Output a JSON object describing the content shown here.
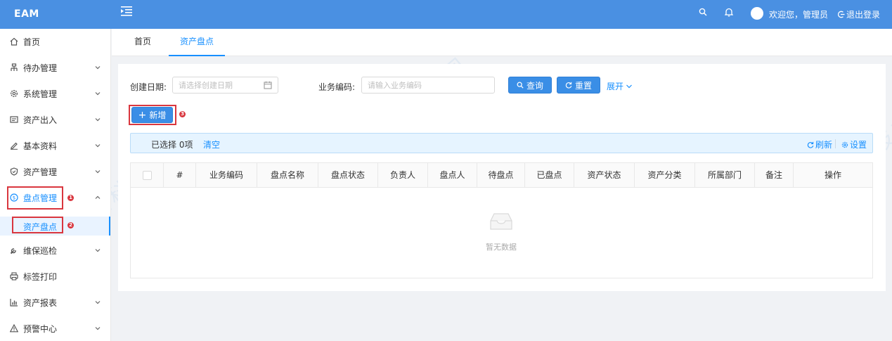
{
  "header": {
    "logo": "EAM",
    "welcome": "欢迎您，管理员",
    "logout": "退出登录"
  },
  "sidebar": {
    "items": [
      {
        "label": "首页",
        "icon": "home-icon",
        "expandable": false
      },
      {
        "label": "待办管理",
        "icon": "todo-icon",
        "expandable": true
      },
      {
        "label": "系统管理",
        "icon": "gear-icon",
        "expandable": true
      },
      {
        "label": "资产出入",
        "icon": "list-icon",
        "expandable": true
      },
      {
        "label": "基本资料",
        "icon": "edit-icon",
        "expandable": true
      },
      {
        "label": "资产管理",
        "icon": "shield-icon",
        "expandable": true
      },
      {
        "label": "盘点管理",
        "icon": "dollar-circle-icon",
        "expandable": true
      },
      {
        "label": "维保巡检",
        "icon": "wrench-icon",
        "expandable": true
      },
      {
        "label": "标签打印",
        "icon": "printer-icon",
        "expandable": false
      },
      {
        "label": "资产报表",
        "icon": "bar-chart-icon",
        "expandable": true
      },
      {
        "label": "预警中心",
        "icon": "warning-icon",
        "expandable": true
      }
    ],
    "subitem": "资产盘点"
  },
  "tabs": [
    {
      "label": "首页"
    },
    {
      "label": "资产盘点"
    }
  ],
  "filters": {
    "date_label": "创建日期:",
    "date_placeholder": "请选择创建日期",
    "code_label": "业务编码:",
    "code_placeholder": "请输入业务编码",
    "query": "查询",
    "reset": "重置",
    "expand": "展开"
  },
  "toolbar": {
    "add": "新增"
  },
  "selection": {
    "selected_text": "已选择 0项",
    "clear": "清空",
    "refresh": "刷新",
    "settings": "设置"
  },
  "table": {
    "columns": [
      "#",
      "业务编码",
      "盘点名称",
      "盘点状态",
      "负责人",
      "盘点人",
      "待盘点",
      "已盘点",
      "资产状态",
      "资产分类",
      "所属部门",
      "备注",
      "操作"
    ],
    "empty_text": "暂无数据"
  },
  "annotations": [
    "1",
    "2",
    "3"
  ],
  "watermark": "北京融海通达科技有限公司",
  "colors": {
    "header_bg": "#4a90e2",
    "accent": "#1890ff",
    "highlight": "#d9363e"
  }
}
